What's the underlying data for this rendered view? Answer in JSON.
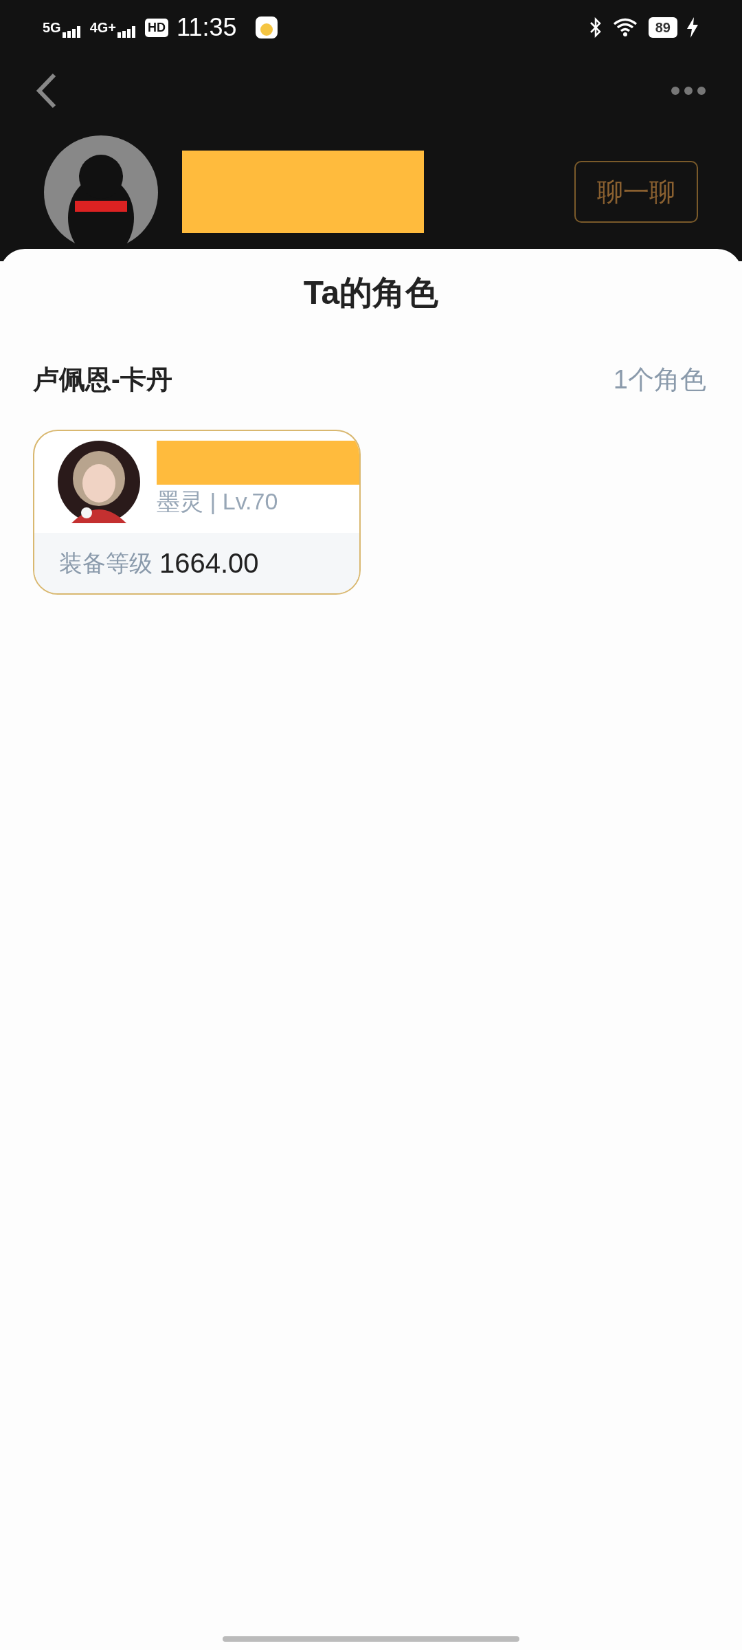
{
  "status_bar": {
    "network_1": "5G",
    "network_2": "4G+",
    "hd": "HD",
    "time": "11:35",
    "battery": "89"
  },
  "profile": {
    "chat_button": "聊一聊"
  },
  "sheet": {
    "title": "Ta的角色",
    "server": {
      "name": "卢佩恩-卡丹",
      "count": "1个角色"
    },
    "characters": [
      {
        "class_level": "墨灵 | Lv.70",
        "gear_label": "装备等级",
        "gear_value": "1664.00"
      }
    ]
  }
}
